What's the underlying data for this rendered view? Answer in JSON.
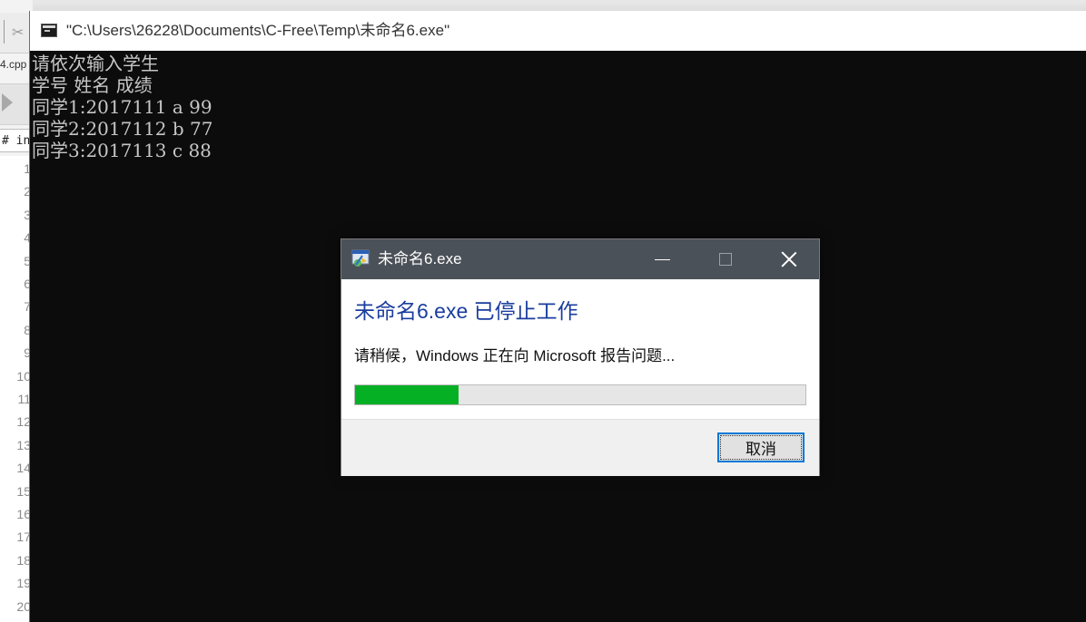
{
  "ide": {
    "tab_name": "4.cpp",
    "file_tab_label": "# in",
    "line_numbers": [
      "1",
      "2",
      "3",
      "4",
      "5",
      "6",
      "7",
      "8",
      "9",
      "10",
      "11",
      "12",
      "13",
      "14",
      "15",
      "16",
      "17",
      "18",
      "19",
      "20"
    ]
  },
  "console": {
    "title": "\"C:\\Users\\26228\\Documents\\C-Free\\Temp\\未命名6.exe\"",
    "lines": [
      "请依次输入学生",
      "学号 姓名 成绩",
      "同学1:2017111 a 99",
      "同学2:2017112 b 77",
      "同学3:2017113 c 88"
    ]
  },
  "dialog": {
    "title": "未命名6.exe",
    "heading": "未命名6.exe 已停止工作",
    "message": "请稍候，Windows 正在向 Microsoft 报告问题...",
    "progress_fraction": 0.23,
    "cancel_label": "取消",
    "colors": {
      "titlebar": "#4b5158",
      "heading": "#1a3d9e",
      "progress": "#06b025",
      "focus_border": "#0078d7"
    }
  }
}
